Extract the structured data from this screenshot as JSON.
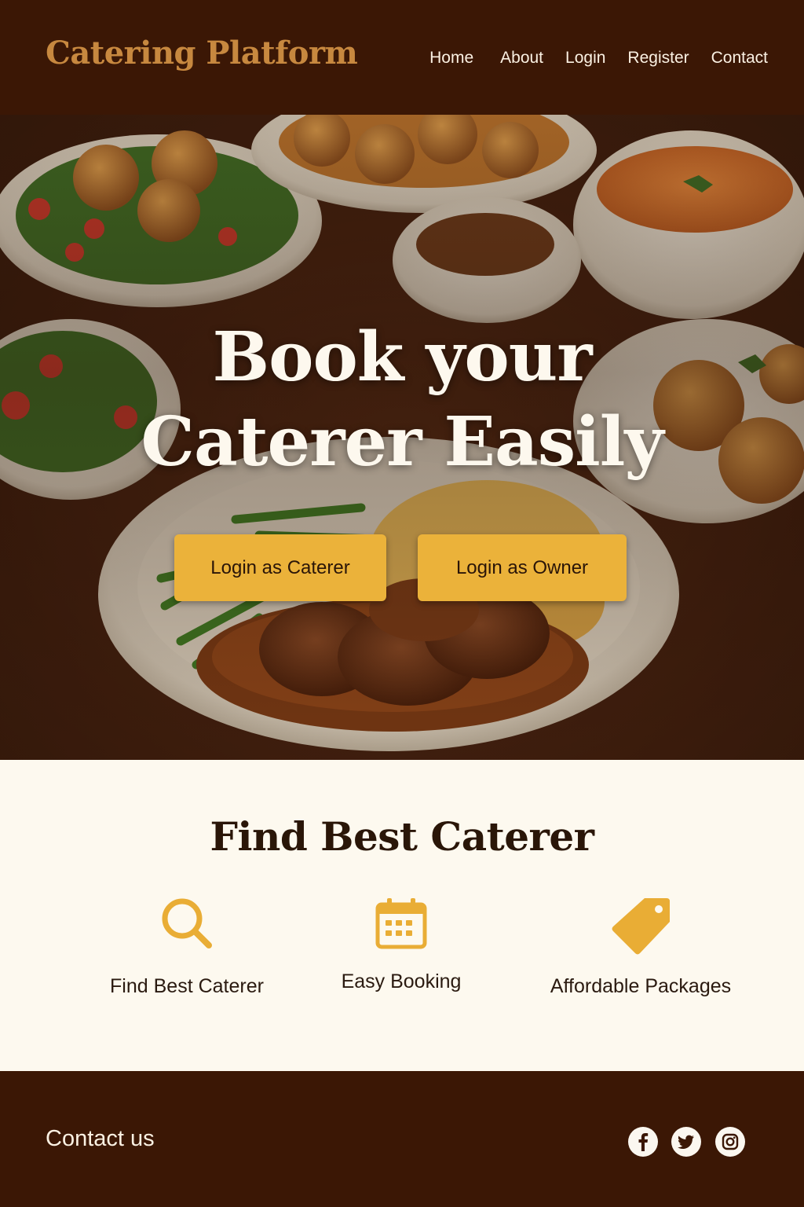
{
  "header": {
    "brand": "Catering Platform",
    "nav": [
      "Home",
      "About",
      "Login",
      "Register",
      "Contact"
    ]
  },
  "hero": {
    "title_line1": "Book your",
    "title_line2": "Caterer Easily",
    "buttons": {
      "caterer": "Login as Caterer",
      "owner": "Login as Owner"
    }
  },
  "features": {
    "title": "Find Best Caterer",
    "items": [
      {
        "label": "Find Best Caterer",
        "icon": "search-icon"
      },
      {
        "label": "Easy Booking",
        "icon": "calendar-icon"
      },
      {
        "label": "Affordable Packages",
        "icon": "price-tag-icon"
      }
    ]
  },
  "footer": {
    "contact": "Contact us",
    "social": [
      "facebook-icon",
      "twitter-icon",
      "instagram-icon"
    ]
  },
  "colors": {
    "header_bg": "#3b1705",
    "brand": "#c7883f",
    "accent": "#ebb23a",
    "section_bg": "#fdf9ef"
  }
}
